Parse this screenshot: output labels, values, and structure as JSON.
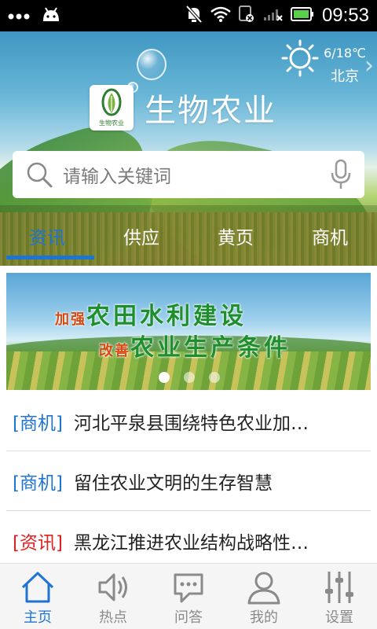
{
  "status_bar": {
    "time": "09:53"
  },
  "weather": {
    "temperature": "6/18℃",
    "city": "北京"
  },
  "brand": {
    "title": "生物农业",
    "logo_text": "生物农业"
  },
  "search": {
    "placeholder": "请输入关键词"
  },
  "tabs": [
    {
      "label": "资讯",
      "active": true
    },
    {
      "label": "供应",
      "active": false
    },
    {
      "label": "黄页",
      "active": false
    },
    {
      "label": "商机",
      "active": false
    }
  ],
  "banner": {
    "line1_small": "加强",
    "line1_big": "农田水利建设",
    "line2_small": "改善",
    "line2_big": "农业生产条件",
    "slide_count": 3,
    "active_slide": 1
  },
  "news": [
    {
      "tag": "[商机]",
      "tag_color": "#1e74d2",
      "title": "河北平泉县围绕特色农业加…"
    },
    {
      "tag": "[商机]",
      "tag_color": "#1e74d2",
      "title": "留住农业文明的生存智慧"
    },
    {
      "tag": "[资讯]",
      "tag_color": "#e02020",
      "title": "黑龙江推进农业结构战略性…"
    }
  ],
  "bottom_nav": [
    {
      "label": "主页",
      "icon": "home-icon",
      "active": true
    },
    {
      "label": "热点",
      "icon": "speaker-icon",
      "active": false
    },
    {
      "label": "问答",
      "icon": "chat-icon",
      "active": false
    },
    {
      "label": "我的",
      "icon": "user-icon",
      "active": false
    },
    {
      "label": "设置",
      "icon": "sliders-icon",
      "active": false
    }
  ],
  "colors": {
    "accent": "#1e74d2",
    "tag_news": "#e02020"
  }
}
